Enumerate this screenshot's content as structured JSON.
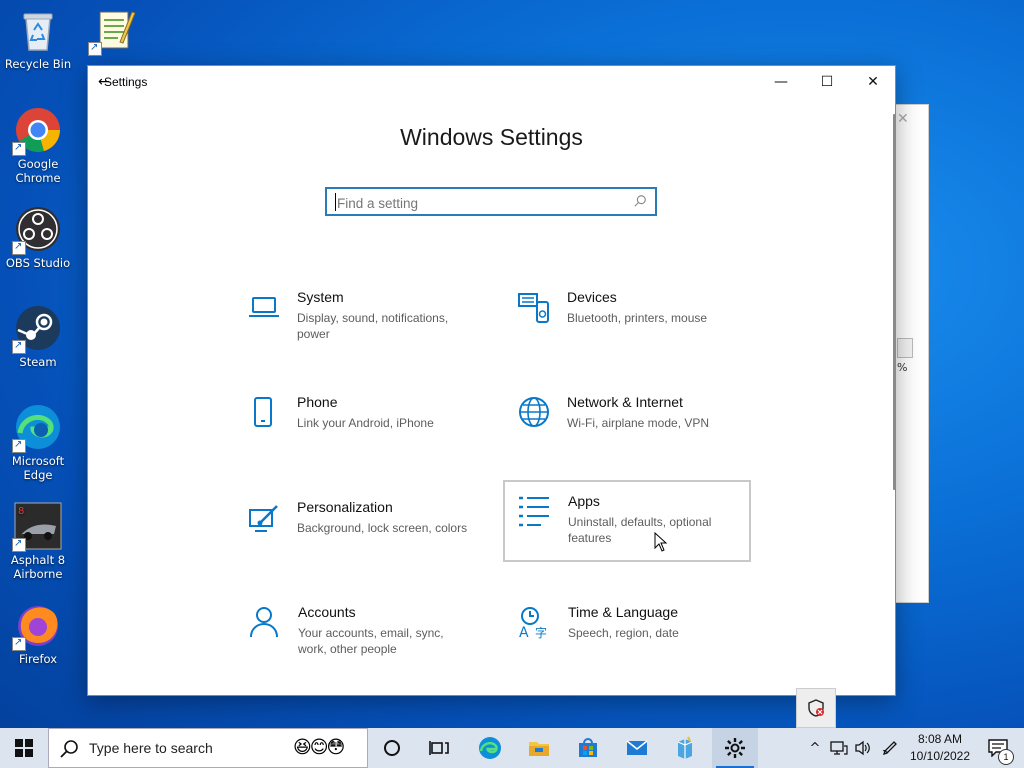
{
  "desktop": {
    "icons": [
      {
        "label": "Recycle Bin",
        "icon": "recycle-bin-icon"
      },
      {
        "label": "Notepad",
        "icon": "notepad-icon"
      },
      {
        "label": "Google Chrome",
        "icon": "chrome-icon"
      },
      {
        "label": "OBS Studio",
        "icon": "obs-icon"
      },
      {
        "label": "Steam",
        "icon": "steam-icon"
      },
      {
        "label": "Microsoft Edge",
        "icon": "edge-icon"
      },
      {
        "label": "Asphalt 8 Airborne",
        "icon": "asphalt-icon"
      },
      {
        "label": "Firefox",
        "icon": "firefox-icon"
      }
    ]
  },
  "background_window": {
    "close_glyph": "✕",
    "percent_text": "%"
  },
  "settings": {
    "title": "Settings",
    "back_glyph": "←",
    "controls": {
      "minimize": "—",
      "maximize": "☐",
      "close": "✕"
    },
    "heading": "Windows Settings",
    "search": {
      "placeholder": "Find a setting",
      "value": ""
    },
    "tiles": [
      {
        "name": "System",
        "desc": "Display, sound, notifications, power",
        "icon": "laptop-icon"
      },
      {
        "name": "Devices",
        "desc": "Bluetooth, printers, mouse",
        "icon": "devices-icon"
      },
      {
        "name": "Phone",
        "desc": "Link your Android, iPhone",
        "icon": "phone-icon"
      },
      {
        "name": "Network & Internet",
        "desc": "Wi-Fi, airplane mode, VPN",
        "icon": "globe-icon"
      },
      {
        "name": "Personalization",
        "desc": "Background, lock screen, colors",
        "icon": "paint-icon"
      },
      {
        "name": "Apps",
        "desc": "Uninstall, defaults, optional features",
        "icon": "apps-list-icon"
      },
      {
        "name": "Accounts",
        "desc": "Your accounts, email, sync, work, other people",
        "icon": "person-icon"
      },
      {
        "name": "Time & Language",
        "desc": "Speech, region, date",
        "icon": "time-language-icon"
      }
    ],
    "hovered_tile": "Apps"
  },
  "taskbar": {
    "search_text": "Type here to search",
    "search_emoji": "😆😊😳",
    "apps": [
      "cortana-icon",
      "task-view-icon",
      "edge-icon",
      "file-explorer-icon",
      "store-icon",
      "mail-icon",
      "package-icon",
      "settings-icon"
    ],
    "active_app": "settings-icon",
    "tray_chevron": "^",
    "clock": {
      "time": "8:08 AM",
      "date": "10/10/2022"
    },
    "notification_count": "1"
  },
  "colors": {
    "accent": "#0067c0",
    "icon_blue": "#0a78c8",
    "taskbar": "#dbe4ef"
  }
}
